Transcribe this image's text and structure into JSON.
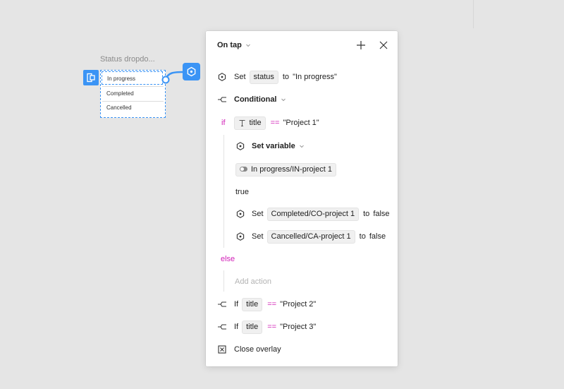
{
  "canvas": {
    "frame_label": "Status dropdo...",
    "frame_items": [
      "In progress",
      "Completed",
      "Cancelled"
    ]
  },
  "panel": {
    "title": "On tap",
    "rows": {
      "set_status": {
        "set": "Set",
        "chip": "status",
        "to": "to",
        "value": "\"In progress\""
      },
      "conditional": {
        "label": "Conditional"
      },
      "if1": {
        "kw": "if",
        "chip": "title",
        "op": "==",
        "value": "\"Project 1\""
      },
      "set_variable": {
        "label": "Set variable"
      },
      "variable_chip": "In progress/IN-project 1",
      "true_value": "true",
      "set_completed": {
        "set": "Set",
        "chip": "Completed/CO-project 1",
        "to": "to",
        "value": "false"
      },
      "set_cancelled": {
        "set": "Set",
        "chip": "Cancelled/CA-project 1",
        "to": "to",
        "value": "false"
      },
      "else_kw": "else",
      "add_action": "Add action",
      "if2": {
        "kw": "If",
        "chip": "title",
        "op": "==",
        "value": "\"Project 2\""
      },
      "if3": {
        "kw": "If",
        "chip": "title",
        "op": "==",
        "value": "\"Project 3\""
      },
      "close_overlay": "Close overlay"
    }
  },
  "colors": {
    "accent": "#3b94f5",
    "keyword": "#d11fb7",
    "panel_bg": "#ffffff",
    "canvas_bg": "#e5e5e5"
  },
  "icons": [
    "component-icon",
    "frame-handle-icon",
    "chevron-down-icon",
    "plus-icon",
    "close-icon",
    "action-hexagon-icon",
    "branch-icon",
    "text-type-icon",
    "boolean-toggle-icon",
    "close-overlay-icon"
  ]
}
